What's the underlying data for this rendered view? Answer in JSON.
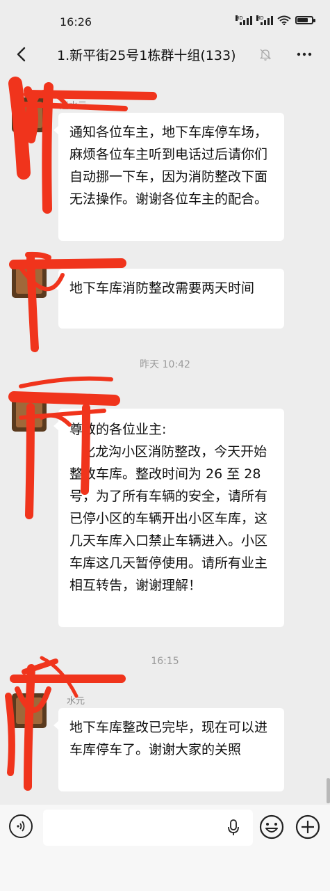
{
  "status_bar": {
    "time": "16:26",
    "signal_1": "HD",
    "signal_2": "HD",
    "battery_level": 0.85
  },
  "header": {
    "title": "1.新平街25号1栋群十组(133)",
    "back_icon": "back-arrow-icon",
    "mute_icon": "bell-muted-icon",
    "more_icon": "more-dots-icon"
  },
  "messages": [
    {
      "type": "message",
      "sender": "赵水元",
      "text": "通知各位车主，地下车库停车场，麻烦各位车主听到电话过后请你们自动挪一下车，因为消防整改下面无法操作。谢谢各位车主的配合。"
    },
    {
      "type": "message",
      "sender": "",
      "text": "地下车库消防整改需要两天时间"
    },
    {
      "type": "timestamp",
      "text": "昨天 10:42"
    },
    {
      "type": "message",
      "sender": "",
      "text": "尊敬的各位业主:\n   化龙沟小区消防整改，今天开始整改车库。整改时间为 26 至 28 号，为了所有车辆的安全，请所有已停小区的车辆开出小区车库，这几天车库入口禁止车辆进入。小区车库这几天暂停使用。请所有业主相互转告，谢谢理解！"
    },
    {
      "type": "timestamp",
      "text": "16:15"
    },
    {
      "type": "message",
      "sender": "水元",
      "text": "地下车库整改已完毕，现在可以进车库停车了。谢谢大家的关照"
    }
  ],
  "input_bar": {
    "placeholder": "",
    "voice_icon": "voice-icon",
    "mic_icon": "microphone-icon",
    "emoji_icon": "emoji-icon",
    "plus_icon": "plus-icon"
  },
  "colors": {
    "background": "#ededed",
    "bubble": "#ffffff",
    "redaction": "#f0341c"
  }
}
